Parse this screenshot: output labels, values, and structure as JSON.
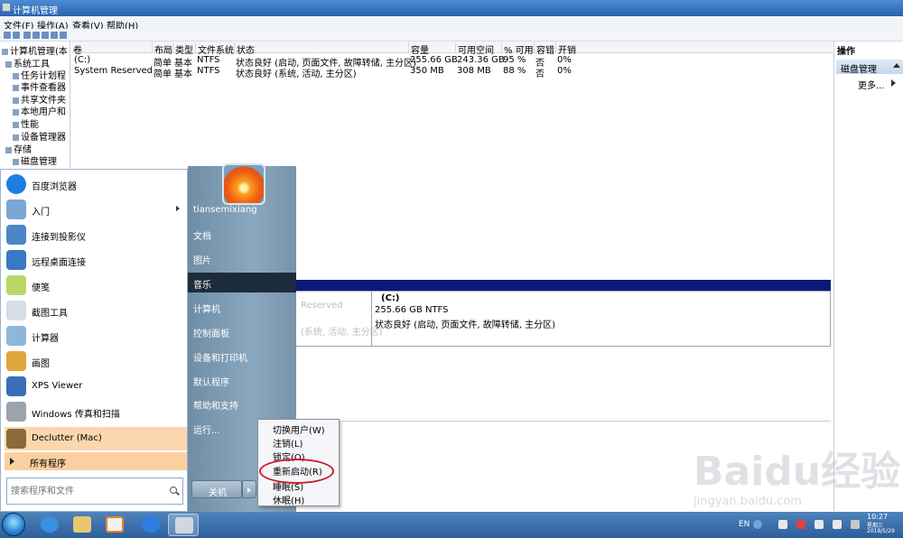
{
  "window": {
    "title": "计算机管理",
    "menu": [
      "文件(F)",
      "操作(A)",
      "查看(V)",
      "帮助(H)"
    ]
  },
  "tree": {
    "items": [
      {
        "label": "计算机管理(本"
      },
      {
        "label": "系统工具"
      },
      {
        "label": "任务计划程"
      },
      {
        "label": "事件查看器"
      },
      {
        "label": "共享文件夹"
      },
      {
        "label": "本地用户和"
      },
      {
        "label": "性能"
      },
      {
        "label": "设备管理器"
      },
      {
        "label": "存储"
      },
      {
        "label": "磁盘管理"
      }
    ]
  },
  "volumes": {
    "columns": [
      "卷",
      "布局",
      "类型",
      "文件系统",
      "状态",
      "容量",
      "可用空间",
      "% 可用",
      "容错",
      "开销"
    ],
    "rows": [
      [
        "(C:)",
        "简单",
        "基本",
        "NTFS",
        "状态良好 (启动, 页面文件, 故障转储, 主分区)",
        "255.66 GB",
        "243.36 GB",
        "95 %",
        "否",
        "0%"
      ],
      [
        "System Reserved",
        "简单",
        "基本",
        "NTFS",
        "状态良好 (系统, 活动, 主分区)",
        "350 MB",
        "308 MB",
        "88 %",
        "否",
        "0%"
      ]
    ]
  },
  "actions": {
    "header": "操作",
    "selected": "磁盘管理",
    "more": "更多..."
  },
  "disk": {
    "partition_name": "(C:)",
    "partition_size": "255.66 GB NTFS",
    "partition_status": "状态良好 (启动, 页面文件, 故障转储, 主分区)",
    "left_line1": "Reserved",
    "left_line2": "(系统, 活动, 主分区)"
  },
  "start_menu": {
    "programs": [
      {
        "label": "百度浏览器",
        "icon": "baidu-browser-icon",
        "color": "#1e7ee0"
      },
      {
        "label": "入门",
        "icon": "getting-started-icon",
        "color": "#7ba7d4",
        "submenu": true
      },
      {
        "label": "连接到投影仪",
        "icon": "projector-icon",
        "color": "#4c86c6"
      },
      {
        "label": "远程桌面连接",
        "icon": "remote-desktop-icon",
        "color": "#3a78c4"
      },
      {
        "label": "便笺",
        "icon": "sticky-notes-icon",
        "color": "#b8d86a"
      },
      {
        "label": "截图工具",
        "icon": "snipping-tool-icon",
        "color": "#d7dde6"
      },
      {
        "label": "计算器",
        "icon": "calculator-icon",
        "color": "#8fb6d9"
      },
      {
        "label": "画图",
        "icon": "paint-icon",
        "color": "#e0a53c"
      },
      {
        "label": "XPS Viewer",
        "icon": "xps-viewer-icon",
        "color": "#3b6fb8"
      },
      {
        "label": "Windows 传真和扫描",
        "icon": "fax-scan-icon",
        "color": "#9aa4ae"
      },
      {
        "label": "Declutter (Mac)",
        "icon": "declutter-icon",
        "color": "#8a6a3a"
      }
    ],
    "all_programs": "所有程序",
    "search_placeholder": "搜索程序和文件",
    "user": "tiansemixiang",
    "right_items": [
      "文档",
      "图片",
      "音乐",
      "计算机",
      "控制面板",
      "设备和打印机",
      "默认程序",
      "帮助和支持",
      "运行..."
    ],
    "shutdown": "关机"
  },
  "power_menu": {
    "items": [
      "切换用户(W)",
      "注销(L)",
      "锁定(O)",
      "重新启动(R)",
      "睡眠(S)",
      "休眠(H)"
    ],
    "highlighted": "重新启动(R)"
  },
  "watermark": {
    "logo": "Baidu经验",
    "url": "jingyan.baidu.com"
  },
  "taskbar": {
    "apps": [
      "ie-icon",
      "explorer-icon",
      "media-player-icon",
      "baidu-browser-icon",
      "computer-management-icon"
    ],
    "language": "EN",
    "time": "10:27",
    "weekday": "星期三",
    "date": "2018/5/29"
  }
}
